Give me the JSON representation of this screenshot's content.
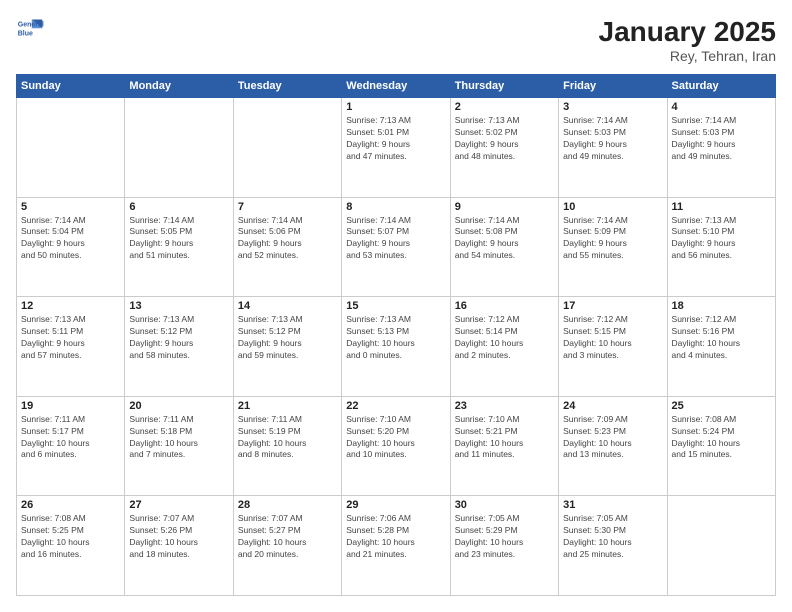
{
  "logo": {
    "line1": "General",
    "line2": "Blue"
  },
  "title": "January 2025",
  "subtitle": "Rey, Tehran, Iran",
  "days_header": [
    "Sunday",
    "Monday",
    "Tuesday",
    "Wednesday",
    "Thursday",
    "Friday",
    "Saturday"
  ],
  "weeks": [
    [
      {
        "day": "",
        "info": ""
      },
      {
        "day": "",
        "info": ""
      },
      {
        "day": "",
        "info": ""
      },
      {
        "day": "1",
        "info": "Sunrise: 7:13 AM\nSunset: 5:01 PM\nDaylight: 9 hours\nand 47 minutes."
      },
      {
        "day": "2",
        "info": "Sunrise: 7:13 AM\nSunset: 5:02 PM\nDaylight: 9 hours\nand 48 minutes."
      },
      {
        "day": "3",
        "info": "Sunrise: 7:14 AM\nSunset: 5:03 PM\nDaylight: 9 hours\nand 49 minutes."
      },
      {
        "day": "4",
        "info": "Sunrise: 7:14 AM\nSunset: 5:03 PM\nDaylight: 9 hours\nand 49 minutes."
      }
    ],
    [
      {
        "day": "5",
        "info": "Sunrise: 7:14 AM\nSunset: 5:04 PM\nDaylight: 9 hours\nand 50 minutes."
      },
      {
        "day": "6",
        "info": "Sunrise: 7:14 AM\nSunset: 5:05 PM\nDaylight: 9 hours\nand 51 minutes."
      },
      {
        "day": "7",
        "info": "Sunrise: 7:14 AM\nSunset: 5:06 PM\nDaylight: 9 hours\nand 52 minutes."
      },
      {
        "day": "8",
        "info": "Sunrise: 7:14 AM\nSunset: 5:07 PM\nDaylight: 9 hours\nand 53 minutes."
      },
      {
        "day": "9",
        "info": "Sunrise: 7:14 AM\nSunset: 5:08 PM\nDaylight: 9 hours\nand 54 minutes."
      },
      {
        "day": "10",
        "info": "Sunrise: 7:14 AM\nSunset: 5:09 PM\nDaylight: 9 hours\nand 55 minutes."
      },
      {
        "day": "11",
        "info": "Sunrise: 7:13 AM\nSunset: 5:10 PM\nDaylight: 9 hours\nand 56 minutes."
      }
    ],
    [
      {
        "day": "12",
        "info": "Sunrise: 7:13 AM\nSunset: 5:11 PM\nDaylight: 9 hours\nand 57 minutes."
      },
      {
        "day": "13",
        "info": "Sunrise: 7:13 AM\nSunset: 5:12 PM\nDaylight: 9 hours\nand 58 minutes."
      },
      {
        "day": "14",
        "info": "Sunrise: 7:13 AM\nSunset: 5:12 PM\nDaylight: 9 hours\nand 59 minutes."
      },
      {
        "day": "15",
        "info": "Sunrise: 7:13 AM\nSunset: 5:13 PM\nDaylight: 10 hours\nand 0 minutes."
      },
      {
        "day": "16",
        "info": "Sunrise: 7:12 AM\nSunset: 5:14 PM\nDaylight: 10 hours\nand 2 minutes."
      },
      {
        "day": "17",
        "info": "Sunrise: 7:12 AM\nSunset: 5:15 PM\nDaylight: 10 hours\nand 3 minutes."
      },
      {
        "day": "18",
        "info": "Sunrise: 7:12 AM\nSunset: 5:16 PM\nDaylight: 10 hours\nand 4 minutes."
      }
    ],
    [
      {
        "day": "19",
        "info": "Sunrise: 7:11 AM\nSunset: 5:17 PM\nDaylight: 10 hours\nand 6 minutes."
      },
      {
        "day": "20",
        "info": "Sunrise: 7:11 AM\nSunset: 5:18 PM\nDaylight: 10 hours\nand 7 minutes."
      },
      {
        "day": "21",
        "info": "Sunrise: 7:11 AM\nSunset: 5:19 PM\nDaylight: 10 hours\nand 8 minutes."
      },
      {
        "day": "22",
        "info": "Sunrise: 7:10 AM\nSunset: 5:20 PM\nDaylight: 10 hours\nand 10 minutes."
      },
      {
        "day": "23",
        "info": "Sunrise: 7:10 AM\nSunset: 5:21 PM\nDaylight: 10 hours\nand 11 minutes."
      },
      {
        "day": "24",
        "info": "Sunrise: 7:09 AM\nSunset: 5:23 PM\nDaylight: 10 hours\nand 13 minutes."
      },
      {
        "day": "25",
        "info": "Sunrise: 7:08 AM\nSunset: 5:24 PM\nDaylight: 10 hours\nand 15 minutes."
      }
    ],
    [
      {
        "day": "26",
        "info": "Sunrise: 7:08 AM\nSunset: 5:25 PM\nDaylight: 10 hours\nand 16 minutes."
      },
      {
        "day": "27",
        "info": "Sunrise: 7:07 AM\nSunset: 5:26 PM\nDaylight: 10 hours\nand 18 minutes."
      },
      {
        "day": "28",
        "info": "Sunrise: 7:07 AM\nSunset: 5:27 PM\nDaylight: 10 hours\nand 20 minutes."
      },
      {
        "day": "29",
        "info": "Sunrise: 7:06 AM\nSunset: 5:28 PM\nDaylight: 10 hours\nand 21 minutes."
      },
      {
        "day": "30",
        "info": "Sunrise: 7:05 AM\nSunset: 5:29 PM\nDaylight: 10 hours\nand 23 minutes."
      },
      {
        "day": "31",
        "info": "Sunrise: 7:05 AM\nSunset: 5:30 PM\nDaylight: 10 hours\nand 25 minutes."
      },
      {
        "day": "",
        "info": ""
      }
    ]
  ]
}
